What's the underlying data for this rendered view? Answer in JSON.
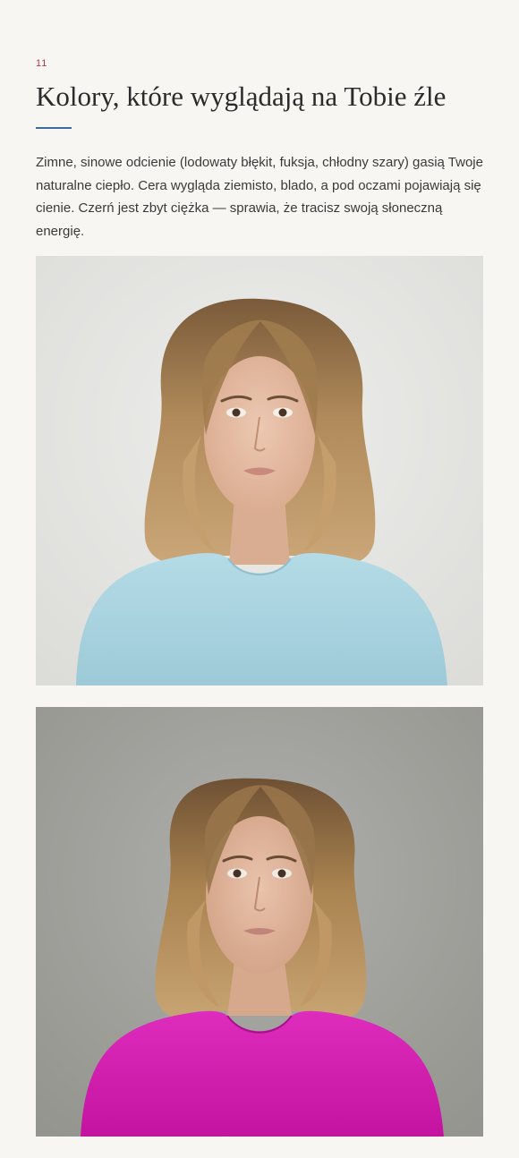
{
  "section": {
    "number": "11",
    "title": "Kolory, które wyglądają na Tobie źle",
    "body": "Zimne, sinowe odcienie (lodowaty błękit, fuksja, chłodny szary) gasią Twoje naturalne ciepło. Cera wygląda ziemisto, blado, a pod oczami pojawiają się cienie. Czerń jest zbyt ciężka — sprawia, że tracisz swoją słoneczną energię."
  },
  "colors": {
    "accent_number": "#b03a4a",
    "accent_rule": "#3d6b9a",
    "page_background": "#f8f6f3",
    "photo_1_background": "#e6e6e3",
    "photo_1_top": "#a9d3df",
    "photo_2_background": "#a3a39f",
    "photo_2_top": "#d219b0",
    "hair": "#b08a5a",
    "skin": "#e6c0a8"
  },
  "photos": [
    {
      "id": "light-blue-top",
      "garment": "light-blue-top"
    },
    {
      "id": "fuchsia-top",
      "garment": "fuchsia-top"
    }
  ]
}
